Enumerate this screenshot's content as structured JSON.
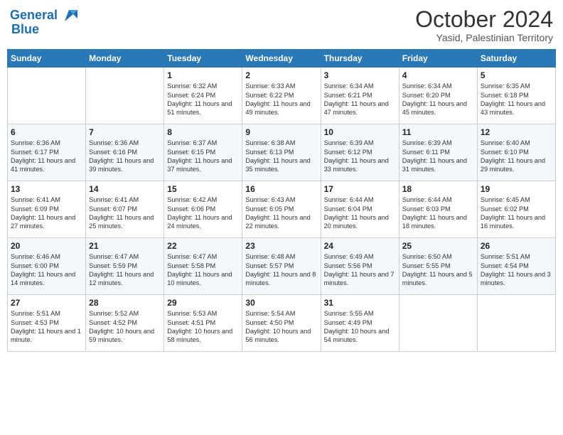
{
  "header": {
    "logo_line1": "General",
    "logo_line2": "Blue",
    "month": "October 2024",
    "location": "Yasid, Palestinian Territory"
  },
  "days_of_week": [
    "Sunday",
    "Monday",
    "Tuesday",
    "Wednesday",
    "Thursday",
    "Friday",
    "Saturday"
  ],
  "weeks": [
    [
      {
        "day": "",
        "info": ""
      },
      {
        "day": "",
        "info": ""
      },
      {
        "day": "1",
        "info": "Sunrise: 6:32 AM\nSunset: 6:24 PM\nDaylight: 11 hours and 51 minutes."
      },
      {
        "day": "2",
        "info": "Sunrise: 6:33 AM\nSunset: 6:22 PM\nDaylight: 11 hours and 49 minutes."
      },
      {
        "day": "3",
        "info": "Sunrise: 6:34 AM\nSunset: 6:21 PM\nDaylight: 11 hours and 47 minutes."
      },
      {
        "day": "4",
        "info": "Sunrise: 6:34 AM\nSunset: 6:20 PM\nDaylight: 11 hours and 45 minutes."
      },
      {
        "day": "5",
        "info": "Sunrise: 6:35 AM\nSunset: 6:18 PM\nDaylight: 11 hours and 43 minutes."
      }
    ],
    [
      {
        "day": "6",
        "info": "Sunrise: 6:36 AM\nSunset: 6:17 PM\nDaylight: 11 hours and 41 minutes."
      },
      {
        "day": "7",
        "info": "Sunrise: 6:36 AM\nSunset: 6:16 PM\nDaylight: 11 hours and 39 minutes."
      },
      {
        "day": "8",
        "info": "Sunrise: 6:37 AM\nSunset: 6:15 PM\nDaylight: 11 hours and 37 minutes."
      },
      {
        "day": "9",
        "info": "Sunrise: 6:38 AM\nSunset: 6:13 PM\nDaylight: 11 hours and 35 minutes."
      },
      {
        "day": "10",
        "info": "Sunrise: 6:39 AM\nSunset: 6:12 PM\nDaylight: 11 hours and 33 minutes."
      },
      {
        "day": "11",
        "info": "Sunrise: 6:39 AM\nSunset: 6:11 PM\nDaylight: 11 hours and 31 minutes."
      },
      {
        "day": "12",
        "info": "Sunrise: 6:40 AM\nSunset: 6:10 PM\nDaylight: 11 hours and 29 minutes."
      }
    ],
    [
      {
        "day": "13",
        "info": "Sunrise: 6:41 AM\nSunset: 6:09 PM\nDaylight: 11 hours and 27 minutes."
      },
      {
        "day": "14",
        "info": "Sunrise: 6:41 AM\nSunset: 6:07 PM\nDaylight: 11 hours and 25 minutes."
      },
      {
        "day": "15",
        "info": "Sunrise: 6:42 AM\nSunset: 6:06 PM\nDaylight: 11 hours and 24 minutes."
      },
      {
        "day": "16",
        "info": "Sunrise: 6:43 AM\nSunset: 6:05 PM\nDaylight: 11 hours and 22 minutes."
      },
      {
        "day": "17",
        "info": "Sunrise: 6:44 AM\nSunset: 6:04 PM\nDaylight: 11 hours and 20 minutes."
      },
      {
        "day": "18",
        "info": "Sunrise: 6:44 AM\nSunset: 6:03 PM\nDaylight: 11 hours and 18 minutes."
      },
      {
        "day": "19",
        "info": "Sunrise: 6:45 AM\nSunset: 6:02 PM\nDaylight: 11 hours and 16 minutes."
      }
    ],
    [
      {
        "day": "20",
        "info": "Sunrise: 6:46 AM\nSunset: 6:00 PM\nDaylight: 11 hours and 14 minutes."
      },
      {
        "day": "21",
        "info": "Sunrise: 6:47 AM\nSunset: 5:59 PM\nDaylight: 11 hours and 12 minutes."
      },
      {
        "day": "22",
        "info": "Sunrise: 6:47 AM\nSunset: 5:58 PM\nDaylight: 11 hours and 10 minutes."
      },
      {
        "day": "23",
        "info": "Sunrise: 6:48 AM\nSunset: 5:57 PM\nDaylight: 11 hours and 8 minutes."
      },
      {
        "day": "24",
        "info": "Sunrise: 6:49 AM\nSunset: 5:56 PM\nDaylight: 11 hours and 7 minutes."
      },
      {
        "day": "25",
        "info": "Sunrise: 6:50 AM\nSunset: 5:55 PM\nDaylight: 11 hours and 5 minutes."
      },
      {
        "day": "26",
        "info": "Sunrise: 5:51 AM\nSunset: 4:54 PM\nDaylight: 11 hours and 3 minutes."
      }
    ],
    [
      {
        "day": "27",
        "info": "Sunrise: 5:51 AM\nSunset: 4:53 PM\nDaylight: 11 hours and 1 minute."
      },
      {
        "day": "28",
        "info": "Sunrise: 5:52 AM\nSunset: 4:52 PM\nDaylight: 10 hours and 59 minutes."
      },
      {
        "day": "29",
        "info": "Sunrise: 5:53 AM\nSunset: 4:51 PM\nDaylight: 10 hours and 58 minutes."
      },
      {
        "day": "30",
        "info": "Sunrise: 5:54 AM\nSunset: 4:50 PM\nDaylight: 10 hours and 56 minutes."
      },
      {
        "day": "31",
        "info": "Sunrise: 5:55 AM\nSunset: 4:49 PM\nDaylight: 10 hours and 54 minutes."
      },
      {
        "day": "",
        "info": ""
      },
      {
        "day": "",
        "info": ""
      }
    ]
  ]
}
